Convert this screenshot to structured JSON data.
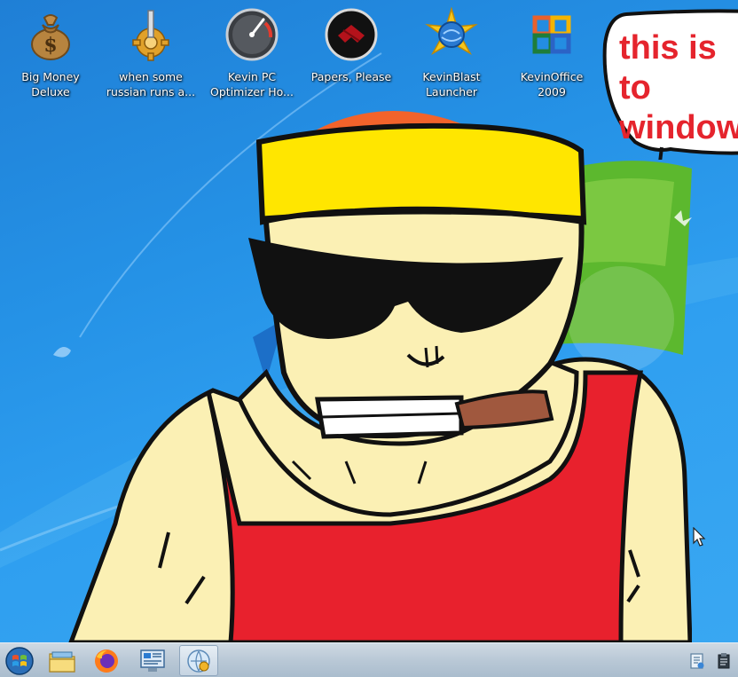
{
  "desktop": {
    "icons": [
      {
        "label": "Big Money\nDeluxe",
        "icon": "money-bag-icon"
      },
      {
        "label": "when some\nrussian runs a...",
        "icon": "gear-icon"
      },
      {
        "label": "Kevin PC\nOptimizer Ho...",
        "icon": "speedometer-icon"
      },
      {
        "label": "Papers, Please",
        "icon": "papers-please-icon"
      },
      {
        "label": "KevinBlast\nLauncher",
        "icon": "star-globe-icon"
      },
      {
        "label": "KevinOffice\n2009",
        "icon": "office-logo-icon"
      }
    ]
  },
  "wallpaper": {
    "speech_bubble_text": "this is to\nwindow"
  },
  "taskbar": {
    "buttons": [
      {
        "icon": "start-orb-icon"
      },
      {
        "icon": "file-explorer-icon"
      },
      {
        "icon": "firefox-icon"
      },
      {
        "icon": "control-panel-icon"
      },
      {
        "icon": "network-app-icon",
        "active": true
      }
    ],
    "tray": [
      {
        "icon": "notification-flag-icon"
      },
      {
        "icon": "clipboard-icon"
      }
    ]
  },
  "colors": {
    "bubble_text": "#e5242d",
    "skin": "#fbf0b4",
    "tank_top": "#e8212d",
    "bandana": "#ffe600"
  }
}
